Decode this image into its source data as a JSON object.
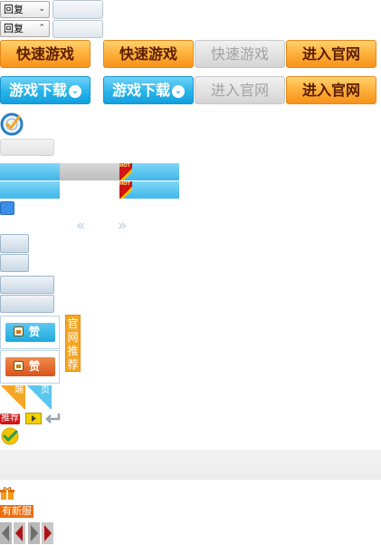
{
  "reply_dropdowns": [
    {
      "label": "回复",
      "caret": "⌄"
    },
    {
      "label": "回复",
      "caret": "⌃"
    }
  ],
  "buttons_row1": [
    {
      "label": "快速游戏",
      "style": "orange"
    },
    {
      "label": "快速游戏",
      "style": "orange"
    },
    {
      "label": "快速游戏",
      "style": "gray"
    },
    {
      "label": "进入官网",
      "style": "orange"
    }
  ],
  "buttons_row2": [
    {
      "label": "游戏下载",
      "style": "blue",
      "chevron": "⌄"
    },
    {
      "label": "游戏下载",
      "style": "blue",
      "chevron": "⌄"
    },
    {
      "label": "进入官网",
      "style": "gray"
    },
    {
      "label": "进入官网",
      "style": "orange"
    }
  ],
  "hot_badge": "HOT",
  "pager_arrows": {
    "prev": "«",
    "next": "»"
  },
  "like_buttons": [
    {
      "label": "赞",
      "color": "#2bb6e0"
    },
    {
      "label": "赞",
      "color": "#e86a2a"
    }
  ],
  "official_recommend": [
    "官",
    "网",
    "推",
    "荐"
  ],
  "corner_tags": {
    "duan": "端",
    "ye": "页"
  },
  "recommend_tag": "推荐",
  "new_server_tag": "有新服",
  "colors": {
    "orange": "#f7921b",
    "blue": "#29b4ea",
    "gray_text": "#a2a2a2",
    "brown_text": "#5a1e00"
  }
}
